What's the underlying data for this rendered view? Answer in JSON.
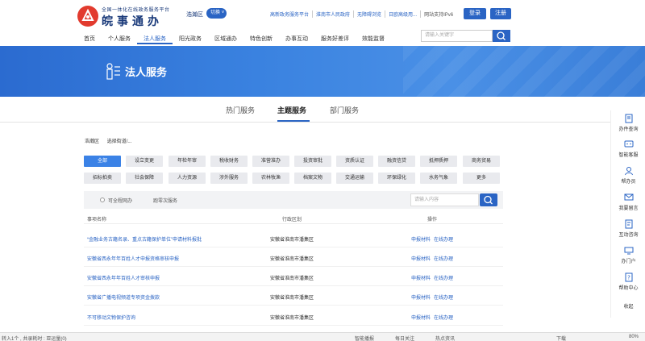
{
  "header": {
    "brand_sub": "全国一体化在线政务服务平台",
    "brand_main": "皖事通办",
    "region": "浩瀚区",
    "switch_label": "切换",
    "links": [
      "高新政务服务平台",
      "淮南市人民政府",
      "无障碍浏览",
      "日欧高级用...",
      "网站支持IPv6"
    ],
    "login": "登录",
    "register": "注册",
    "nav": [
      "首页",
      "个人服务",
      "法人服务",
      "阳光政务",
      "区域通办",
      "特色创新",
      "办事互动",
      "服务好差评",
      "效能监督"
    ],
    "active_nav": 2,
    "search_placeholder": "请输入关键字"
  },
  "banner": {
    "title": "法人服务"
  },
  "tabs": [
    "热门服务",
    "主题服务",
    "部门服务"
  ],
  "active_tab": 1,
  "region_filter": {
    "label": "浩瀚区",
    "select": "选择街道/..."
  },
  "chips": [
    "全部",
    "设立变更",
    "年检年审",
    "税收财务",
    "准营准办",
    "投资审批",
    "资质认证",
    "融资信贷",
    "抵押质押",
    "商务贸易",
    "招标拍卖",
    "社会保障",
    "人力资源",
    "涉外服务",
    "农林牧渔",
    "档案文物",
    "交通运输",
    "环保绿化",
    "水务气象",
    "更多"
  ],
  "active_chip": 0,
  "filterbar": {
    "option1": "可全程网办",
    "option2": "跑零次服务",
    "search_placeholder": "请输入内容"
  },
  "table": {
    "headers": [
      "事项名称",
      "行政区划",
      "操作"
    ],
    "rows": [
      {
        "name": "“金融业务古籍名录、重点古籍保护单位”申请材料报批",
        "dept": "安徽省淮南市潘集区",
        "op1": "申报材料",
        "op2": "在线办理"
      },
      {
        "name": "安徽省西永年年百姓人才申报资格审核申报",
        "dept": "安徽省淮南市潘集区",
        "op1": "申报材料",
        "op2": "在线办理"
      },
      {
        "name": "安徽省西永年年百姓人才审核申报",
        "dept": "安徽省淮南市潘集区",
        "op1": "申报材料",
        "op2": "在线办理"
      },
      {
        "name": "安徽省广播电视频道专项资金拨款",
        "dept": "安徽省淮南市潘集区",
        "op1": "申报材料",
        "op2": "在线办理"
      },
      {
        "name": "不可移动文物保护咨询",
        "dept": "安徽省淮南市潘集区",
        "op1": "申报材料",
        "op2": "在线办理"
      }
    ]
  },
  "sidebar": [
    "办件查询",
    "智能客服",
    "帮办员",
    "我要留言",
    "互动咨询",
    "办门户",
    "帮助中心",
    "收起"
  ],
  "statusbar": {
    "left": "转入1个 , 共录耗时 : 亚运量(0)",
    "mid1": "智能播报",
    "mid2": "每日关注",
    "mid3": "热点资讯",
    "right1": "下载",
    "right2": "80%"
  },
  "colors": {
    "primary": "#2a64c4",
    "logo_red": "#e23b2e",
    "chip_bg": "#e9eaee"
  }
}
